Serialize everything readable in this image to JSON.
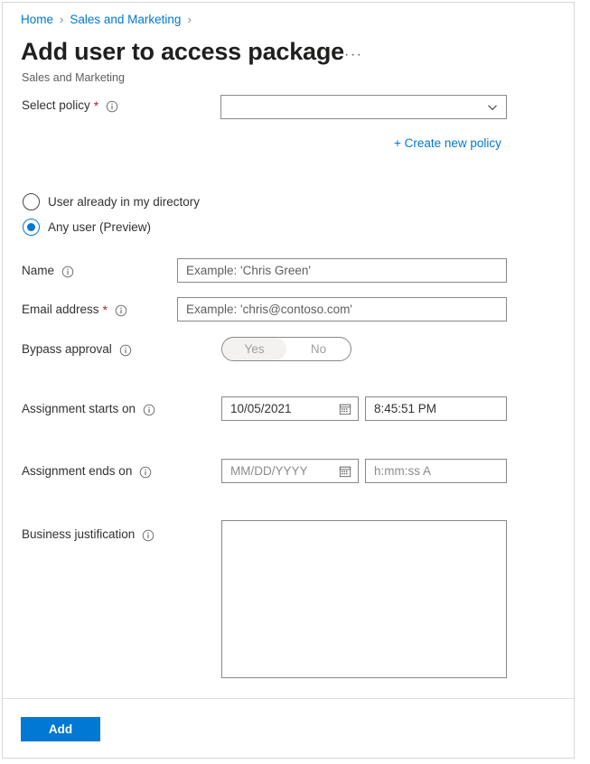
{
  "breadcrumb": {
    "items": [
      {
        "label": "Home"
      },
      {
        "label": "Sales and Marketing"
      }
    ],
    "separator": "›"
  },
  "header": {
    "title": "Add user to access package",
    "subtitle": "Sales and Marketing",
    "overflow_label": "···"
  },
  "form": {
    "select_policy": {
      "label": "Select policy",
      "required_marker": "*",
      "info_icon": "info-icon",
      "value": "",
      "chevron_icon": "chevron-down-icon"
    },
    "create_new_policy_link": "+ Create new policy",
    "user_scope": {
      "options": [
        {
          "label": "User already in my directory",
          "selected": false
        },
        {
          "label": "Any user (Preview)",
          "selected": true
        }
      ]
    },
    "name": {
      "label": "Name",
      "info_icon": "info-icon",
      "placeholder": "Example: 'Chris Green'",
      "value": ""
    },
    "email": {
      "label": "Email address",
      "required_marker": "*",
      "info_icon": "info-icon",
      "placeholder": "Example: 'chris@contoso.com'",
      "value": ""
    },
    "bypass_approval": {
      "label": "Bypass approval",
      "info_icon": "info-icon",
      "options": [
        "Yes",
        "No"
      ],
      "selected": "Yes"
    },
    "assignment_starts_on": {
      "label": "Assignment starts on",
      "info_icon": "info-icon",
      "date_value": "10/05/2021",
      "date_is_placeholder": false,
      "calendar_icon": "calendar-icon",
      "time_value": "8:45:51 PM",
      "time_is_placeholder": false
    },
    "assignment_ends_on": {
      "label": "Assignment ends on",
      "info_icon": "info-icon",
      "date_value": "MM/DD/YYYY",
      "date_is_placeholder": true,
      "calendar_icon": "calendar-icon",
      "time_value": "h:mm:ss A",
      "time_is_placeholder": true
    },
    "business_justification": {
      "label": "Business justification",
      "info_icon": "info-icon",
      "value": "",
      "placeholder": ""
    }
  },
  "footer": {
    "submit_label": "Add"
  },
  "colors": {
    "accent": "#0078d4",
    "required": "#a4262c",
    "border": "#8a8886",
    "text": "#323130",
    "muted": "#605e5c"
  }
}
